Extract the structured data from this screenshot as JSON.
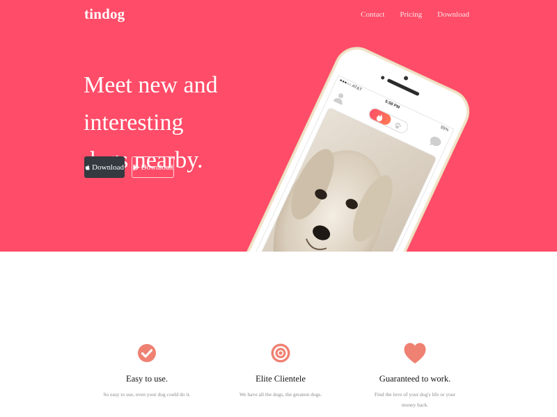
{
  "brand": {
    "name": "tindog"
  },
  "nav": {
    "items": [
      {
        "label": "Contact"
      },
      {
        "label": "Pricing"
      },
      {
        "label": "Download"
      }
    ]
  },
  "hero": {
    "headline_line1": "Meet new and interesting",
    "headline_line2": "dogs nearby.",
    "buttons": {
      "apple": {
        "label": "Download",
        "icon": "apple-icon"
      },
      "google": {
        "label": "Download",
        "icon": "google-play-icon"
      }
    }
  },
  "phone": {
    "carrier": "●●●○○ AT&T",
    "time": "5:58 PM",
    "battery": "55%"
  },
  "features": [
    {
      "icon": "check-circle-icon",
      "title": "Easy to use.",
      "text": "So easy to use, even your dog could do it."
    },
    {
      "icon": "bullseye-icon",
      "title": "Elite Clientele",
      "text": "We have all the dogs, the greatest dogs."
    },
    {
      "icon": "heart-icon",
      "title": "Guaranteed to work.",
      "text": "Find the love of your dog's life or your money back."
    }
  ],
  "colors": {
    "brand": "#ff4c68",
    "icon_accent": "#ef8172",
    "button_dark": "#343a40"
  }
}
